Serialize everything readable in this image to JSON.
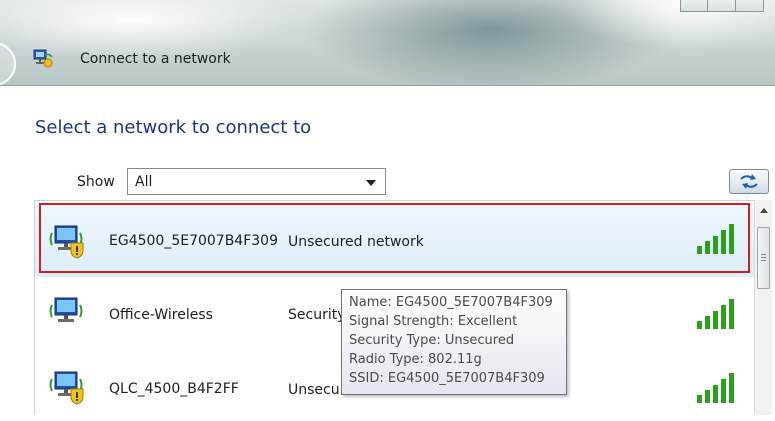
{
  "window": {
    "title": "Connect to a network"
  },
  "heading": "Select a network to connect to",
  "filter": {
    "label": "Show",
    "selected": "All"
  },
  "networks": [
    {
      "name": "EG4500_5E7007B4F309",
      "status": "Unsecured network",
      "selected": true,
      "signal_bars": 5,
      "warning_shield": true
    },
    {
      "name": "Office-Wireless",
      "status": "Security",
      "selected": false,
      "signal_bars": 5,
      "warning_shield": false
    },
    {
      "name": "QLC_4500_B4F2FF",
      "status": "Unsecu",
      "selected": false,
      "signal_bars": 5,
      "warning_shield": true
    }
  ],
  "tooltip": {
    "lines": [
      "Name: EG4500_5E7007B4F309",
      "Signal Strength: Excellent",
      "Security Type: Unsecured",
      "Radio Type: 802.11g",
      "SSID: EG4500_5E7007B4F309"
    ]
  },
  "colors": {
    "heading": "#1e3287",
    "selection_outline": "#d41e1e",
    "signal_green": "#2e9e1e",
    "selected_row_bg": "#dcedfb"
  },
  "icons": {
    "title": "network-icon",
    "refresh": "refresh-icon",
    "network": "wireless-network-icon",
    "signal": "signal-strength-icon"
  }
}
